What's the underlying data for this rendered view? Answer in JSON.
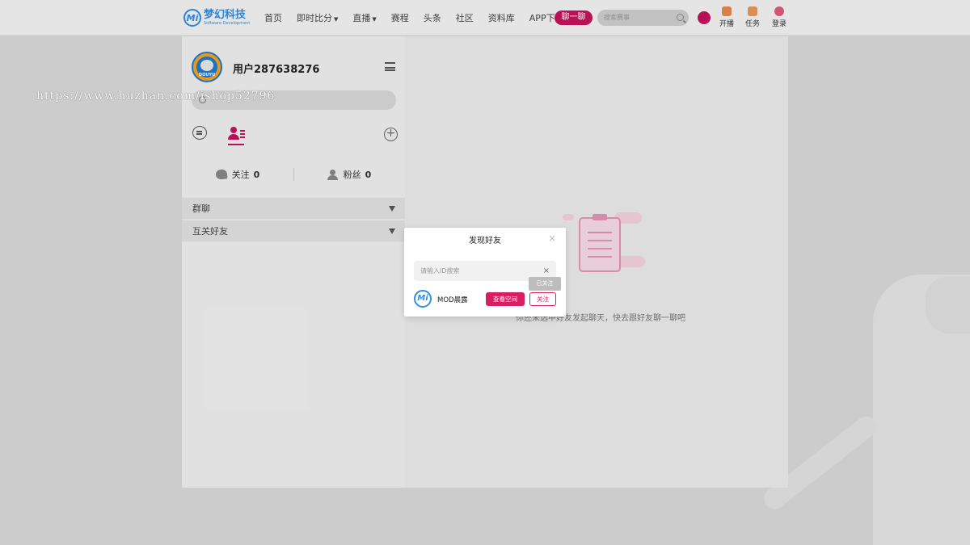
{
  "header": {
    "logo": {
      "name": "梦幻科技",
      "tagline": "Software Development",
      "badge": "Mi"
    },
    "nav": [
      {
        "label": "首页",
        "dropdown": false
      },
      {
        "label": "即时比分",
        "dropdown": true
      },
      {
        "label": "直播",
        "dropdown": true
      },
      {
        "label": "赛程",
        "dropdown": false
      },
      {
        "label": "头条",
        "dropdown": false
      },
      {
        "label": "社区",
        "dropdown": false
      },
      {
        "label": "资料库",
        "dropdown": false
      },
      {
        "label": "APP下载",
        "dropdown": false
      }
    ],
    "chat_button": "聊一聊",
    "search_placeholder": "搜索赛事",
    "actions": [
      {
        "label": "开播",
        "icon": "broadcast-icon"
      },
      {
        "label": "任务",
        "icon": "task-icon"
      },
      {
        "label": "登录",
        "icon": "user-icon"
      }
    ]
  },
  "watermark": "https://www.huzhan.com/ishop52796",
  "sidebar": {
    "avatar_text": "DOUYU",
    "username": "用户287638276",
    "follow": {
      "label": "关注",
      "count": "0"
    },
    "fans": {
      "label": "粉丝",
      "count": "0"
    },
    "groups": [
      {
        "label": "群聊"
      },
      {
        "label": "互关好友"
      }
    ]
  },
  "main": {
    "empty_text": "你还未选中好友发起聊天，快去跟好友聊一聊吧"
  },
  "modal": {
    "title": "发现好友",
    "close": "×",
    "input_placeholder": "请输入ID搜索",
    "clear": "×",
    "tooltip": "已关注",
    "result": {
      "avatar": "Mi",
      "name": "MOD晨露",
      "view_button": "查看空间",
      "follow_button": "关注"
    }
  },
  "colors": {
    "accent": "#d81e62",
    "brand": "#2f8ee5"
  }
}
